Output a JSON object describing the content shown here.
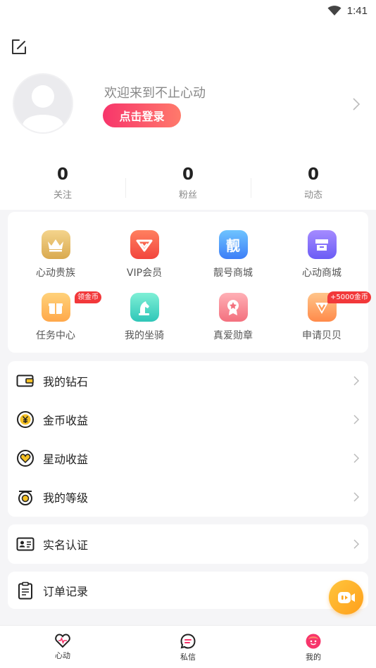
{
  "status": {
    "time": "1:41"
  },
  "profile": {
    "welcome": "欢迎来到不止心动",
    "login_label": "点击登录"
  },
  "stats": [
    {
      "num": "0",
      "label": "关注"
    },
    {
      "num": "0",
      "label": "粉丝"
    },
    {
      "num": "0",
      "label": "动态"
    }
  ],
  "features": [
    {
      "label": "心动贵族",
      "icon": "crown-icon"
    },
    {
      "label": "VIP会员",
      "icon": "vip-diamond-icon"
    },
    {
      "label": "靓号商城",
      "icon": "pretty-number-icon",
      "glyph": "靓"
    },
    {
      "label": "心动商城",
      "icon": "shop-icon"
    },
    {
      "label": "任务中心",
      "icon": "gift-box-icon",
      "tag": "领金币"
    },
    {
      "label": "我的坐骑",
      "icon": "knight-icon"
    },
    {
      "label": "真爱勋章",
      "icon": "medal-icon"
    },
    {
      "label": "申请贝贝",
      "icon": "beibei-icon",
      "tag": "+5000金币"
    }
  ],
  "menu": [
    {
      "label": "我的钻石",
      "icon": "wallet-icon"
    },
    {
      "label": "金币收益",
      "icon": "yuan-coin-icon"
    },
    {
      "label": "星动收益",
      "icon": "heart-coin-icon"
    },
    {
      "label": "我的等级",
      "icon": "level-icon"
    }
  ],
  "verify": {
    "label": "实名认证",
    "icon": "id-card-icon"
  },
  "orders": {
    "label": "订单记录",
    "icon": "clipboard-icon"
  },
  "nav": [
    {
      "label": "心动",
      "icon": "heart-pulse-icon"
    },
    {
      "label": "私信",
      "icon": "message-icon"
    },
    {
      "label": "我的",
      "icon": "me-face-icon"
    }
  ],
  "colors": {
    "accent_gradient_start": "#f7356b",
    "accent_gradient_end": "#ff7a6b",
    "tag_red": "#f2383a",
    "float_orange": "#ffa51f"
  }
}
